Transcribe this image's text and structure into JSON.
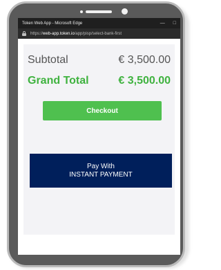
{
  "browser": {
    "window_title": "Token Web App - Microsoft Edge",
    "controls": [
      "—",
      "□"
    ],
    "url_prefix": "https://",
    "url_host": "web-app.token.io",
    "url_path": "/app/pisp/select-bank-first"
  },
  "summary": {
    "subtotal_label": "Subtotal",
    "subtotal_value": "€ 3,500.00",
    "grand_total_label": "Grand Total",
    "grand_total_value": "€ 3,500.00"
  },
  "checkout": {
    "label": "Checkout"
  },
  "pay": {
    "line1": "Pay With",
    "line2": "INSTANT PAYMENT"
  }
}
